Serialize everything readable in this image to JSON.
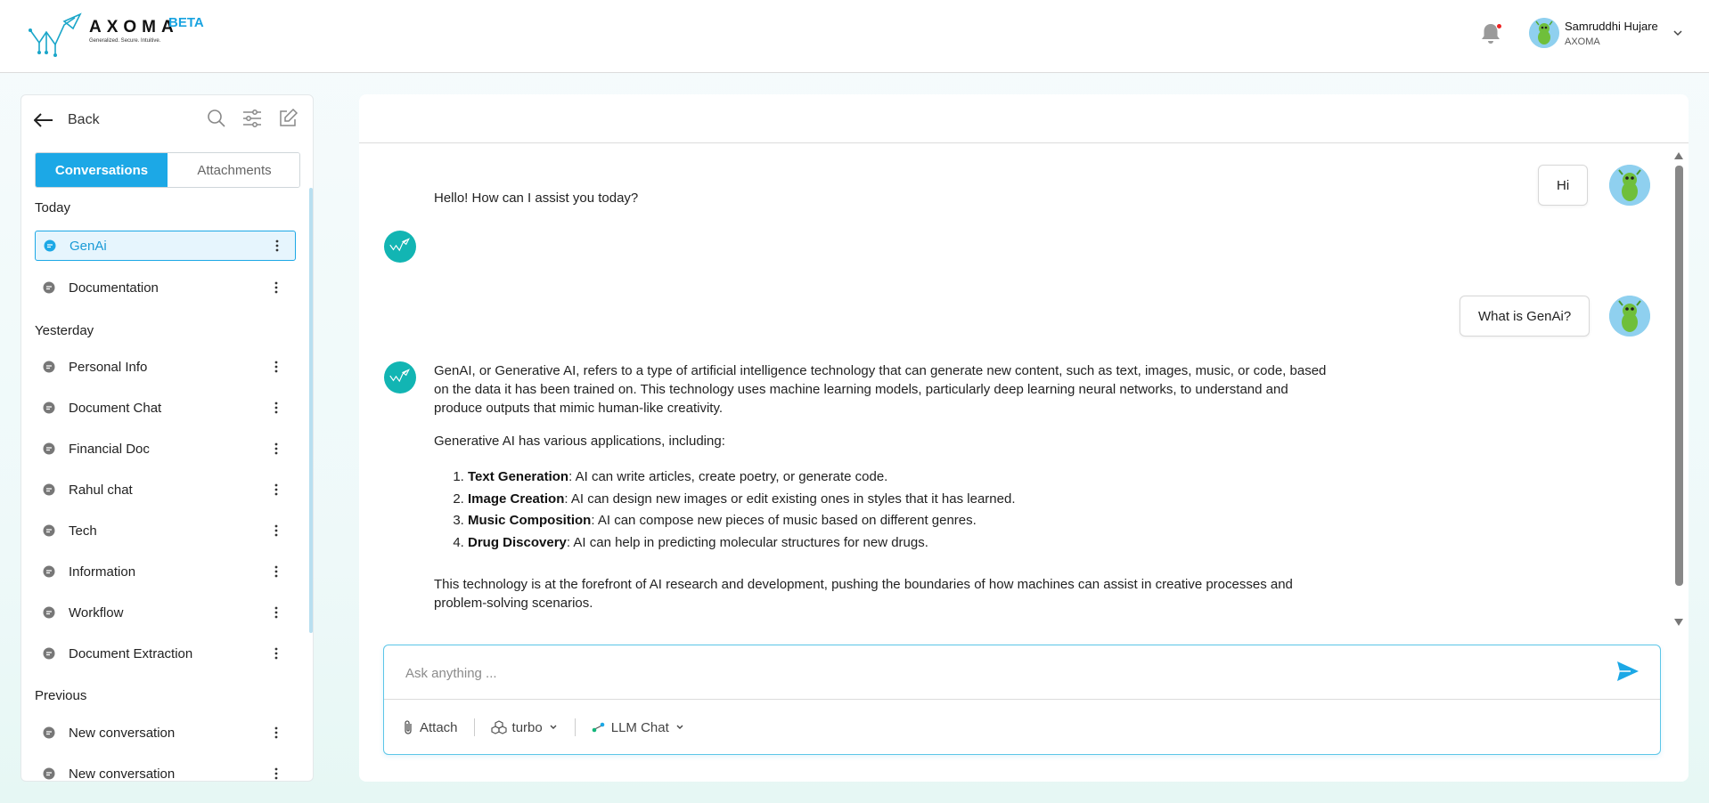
{
  "header": {
    "brand": "AXOMA",
    "tagline": "Generalized. Secure. Intuitive.",
    "beta_label": "BETA",
    "user_name": "Samruddhi Hujare",
    "user_org": "AXOMA"
  },
  "sidebar": {
    "back_label": "Back",
    "tabs": [
      {
        "label": "Conversations",
        "active": true
      },
      {
        "label": "Attachments",
        "active": false
      }
    ],
    "sections": [
      {
        "label": "Today",
        "items": [
          {
            "label": "GenAi",
            "active": true
          },
          {
            "label": "Documentation",
            "active": false
          }
        ]
      },
      {
        "label": "Yesterday",
        "items": [
          {
            "label": "Personal Info"
          },
          {
            "label": "Document Chat"
          },
          {
            "label": "Financial Doc"
          },
          {
            "label": "Rahul chat"
          },
          {
            "label": "Tech"
          },
          {
            "label": "Information"
          },
          {
            "label": "Workflow"
          },
          {
            "label": "Document Extraction"
          }
        ]
      },
      {
        "label": "Previous",
        "items": [
          {
            "label": "New conversation"
          },
          {
            "label": "New conversation"
          }
        ]
      }
    ]
  },
  "chat": {
    "messages": [
      {
        "role": "user",
        "text": "Hi"
      },
      {
        "role": "assistant",
        "text": "Hello! How can I assist you today?"
      },
      {
        "role": "user",
        "text": "What is GenAi?"
      },
      {
        "role": "assistant",
        "intro_line1": "GenAI, or Generative AI, refers to a type of artificial intelligence technology that can generate new content, such as text, images, music, or code, based",
        "intro_line2": "on the data it has been trained on. This technology uses machine learning models, particularly deep learning neural networks, to understand and",
        "intro_line3": "produce outputs that mimic human-like creativity.",
        "applications_intro": "Generative AI has various applications, including:",
        "list": [
          {
            "term": "Text Generation",
            "desc": ": AI can write articles, create poetry, or generate code."
          },
          {
            "term": "Image Creation",
            "desc": ": AI can design new images or edit existing ones in styles that it has learned."
          },
          {
            "term": "Music Composition",
            "desc": ": AI can compose new pieces of music based on different genres."
          },
          {
            "term": "Drug Discovery",
            "desc": ": AI can help in predicting molecular structures for new drugs."
          }
        ],
        "outro_line1": "This technology is at the forefront of AI research and development, pushing the boundaries of how machines can assist in creative processes and",
        "outro_line2": "problem-solving scenarios."
      }
    ]
  },
  "composer": {
    "placeholder": "Ask anything ...",
    "attach_label": "Attach",
    "model_label": "turbo",
    "mode_label": "LLM Chat"
  },
  "colors": {
    "accent": "#1ca8e6",
    "bot_avatar": "#12b5b3",
    "notification_dot": "#e22222"
  }
}
